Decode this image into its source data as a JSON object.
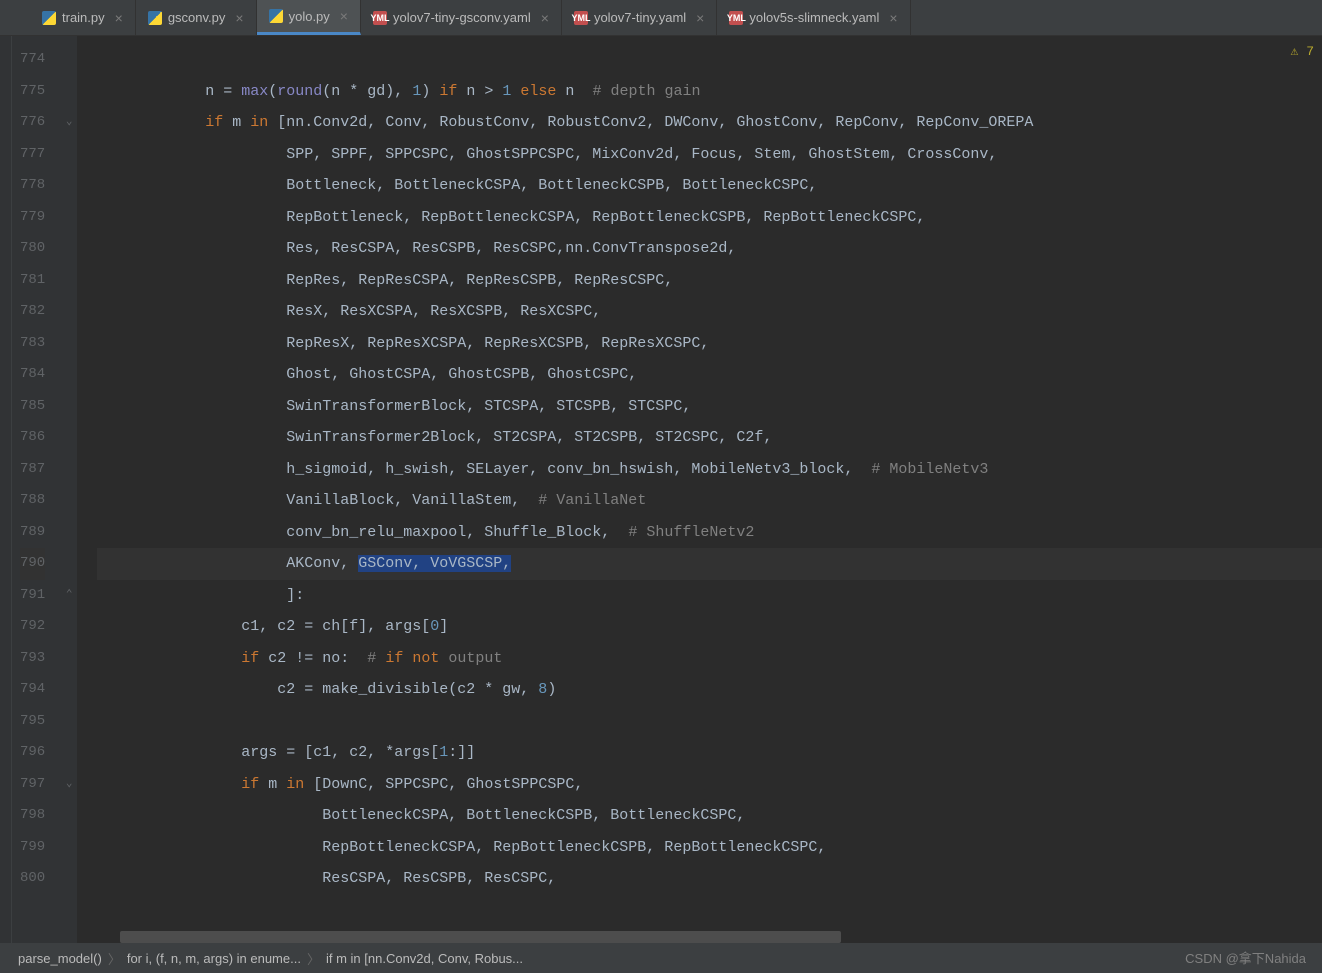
{
  "tabs": [
    {
      "name": "train.py",
      "icon": "py"
    },
    {
      "name": "gsconv.py",
      "icon": "py"
    },
    {
      "name": "yolo.py",
      "icon": "py",
      "active": true
    },
    {
      "name": "yolov7-tiny-gsconv.yaml",
      "icon": "yaml"
    },
    {
      "name": "yolov7-tiny.yaml",
      "icon": "yaml"
    },
    {
      "name": "yolov5s-slimneck.yaml",
      "icon": "yaml"
    }
  ],
  "warning_count": "7",
  "line_start": 774,
  "lines": [
    "",
    "            n = max(round(n * gd), 1) if n > 1 else n  # depth gain",
    "            if m in [nn.Conv2d, Conv, RobustConv, RobustConv2, DWConv, GhostConv, RepConv, RepConv_OREPA",
    "                     SPP, SPPF, SPPCSPC, GhostSPPCSPC, MixConv2d, Focus, Stem, GhostStem, CrossConv,",
    "                     Bottleneck, BottleneckCSPA, BottleneckCSPB, BottleneckCSPC,",
    "                     RepBottleneck, RepBottleneckCSPA, RepBottleneckCSPB, RepBottleneckCSPC,",
    "                     Res, ResCSPA, ResCSPB, ResCSPC,nn.ConvTranspose2d,",
    "                     RepRes, RepResCSPA, RepResCSPB, RepResCSPC,",
    "                     ResX, ResXCSPA, ResXCSPB, ResXCSPC,",
    "                     RepResX, RepResXCSPA, RepResXCSPB, RepResXCSPC,",
    "                     Ghost, GhostCSPA, GhostCSPB, GhostCSPC,",
    "                     SwinTransformerBlock, STCSPA, STCSPB, STCSPC,",
    "                     SwinTransformer2Block, ST2CSPA, ST2CSPB, ST2CSPC, C2f,",
    "                     h_sigmoid, h_swish, SELayer, conv_bn_hswish, MobileNetv3_block,  # MobileNetv3",
    "                     VanillaBlock, VanillaStem,  # VanillaNet",
    "                     conv_bn_relu_maxpool, Shuffle_Block,  # ShuffleNetv2",
    "                     AKConv, GSConv, VoVGSCSP,",
    "                     ]:",
    "                c1, c2 = ch[f], args[0]",
    "                if c2 != no:  # if not output",
    "                    c2 = make_divisible(c2 * gw, 8)",
    "",
    "                args = [c1, c2, *args[1:]]",
    "                if m in [DownC, SPPCSPC, GhostSPPCSPC,",
    "                         BottleneckCSPA, BottleneckCSPB, BottleneckCSPC,",
    "                         RepBottleneckCSPA, RepBottleneckCSPB, RepBottleneckCSPC,",
    "                         ResCSPA, ResCSPB, ResCSPC,"
  ],
  "current_line": 790,
  "selection": {
    "line": 790,
    "text": "GSConv, VoVGSCSP,"
  },
  "folds": {
    "776": "down",
    "791": "up",
    "797": "down"
  },
  "breadcrumb": [
    "parse_model()",
    "for i, (f, n, m, args) in enume...",
    "if m in [nn.Conv2d, Conv, Robus..."
  ],
  "watermark": "CSDN @拿下Nahida"
}
